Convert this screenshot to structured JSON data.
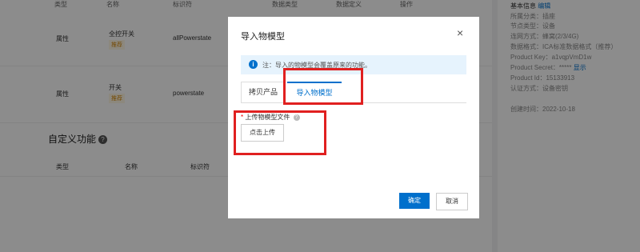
{
  "table": {
    "headers": [
      "类型",
      "名称",
      "标识符",
      "数据类型",
      "数据定义",
      "操作"
    ],
    "rows": [
      {
        "type": "属性",
        "name": "全控开关",
        "tag": "推荐",
        "identifier": "allPowerstate"
      },
      {
        "type": "属性",
        "name": "开关",
        "tag": "推荐",
        "identifier": "powerstate"
      }
    ]
  },
  "custom_section": {
    "title": "自定义功能",
    "help_icon": "?",
    "headers": [
      "类型",
      "名称",
      "标识符"
    ]
  },
  "sidebar": {
    "title": "基本信息",
    "edit": "编辑",
    "category": "所属分类：插座",
    "node_type": "节点类型：设备",
    "network": "连网方式：蜂窝(2/3/4G)",
    "data_format": "数据格式：ICA标准数据格式（推荐）",
    "product_key": "Product Key：a1vqpVmD1w",
    "product_secret": "Product Secret：*****",
    "show": "显示",
    "product_id": "Product Id：15133913",
    "auth": "认证方式：设备密钥",
    "created": "创建时间：2022-10-18"
  },
  "modal": {
    "title": "导入物模型",
    "close": "×",
    "notice": "注：导入的物模型会覆盖原来的功能。",
    "tabs": [
      {
        "label": "拷贝产品"
      },
      {
        "label": "导入物模型"
      }
    ],
    "upload_label": "上传物模型文件",
    "upload_button": "点击上传",
    "confirm": "确定",
    "cancel": "取消"
  },
  "colors": {
    "accent": "#0070cc",
    "highlight": "#e02020"
  }
}
